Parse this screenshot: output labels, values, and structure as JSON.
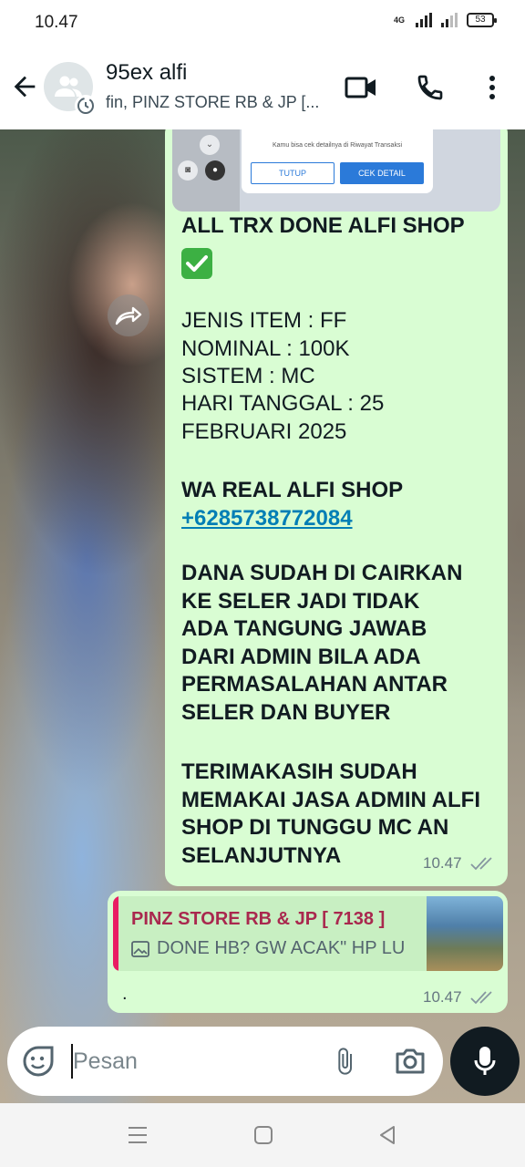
{
  "status_bar": {
    "time": "10.47",
    "network": "4G",
    "battery": "53"
  },
  "header": {
    "title": "95ex alfi",
    "subtitle": "fin, PINZ STORE RB & JP [..."
  },
  "preview": {
    "dialog_text": "Kamu bisa cek detailnya di Riwayat Transaksi",
    "btn_close": "TUTUP",
    "btn_detail": "CEK DETAIL"
  },
  "message1": {
    "headline": "ALL TRX DONE  ALFI SHOP",
    "emoji": "✅",
    "line1": "JENIS ITEM : FF",
    "line2": "NOMINAL : 100K",
    "line3": "SISTEM : MC",
    "line4": "HARI TANGGAL : 25",
    "line5": "FEBRUARI 2025",
    "wa_label": "WA REAL ALFI SHOP",
    "phone": "+6285738772084",
    "notice": "DANA SUDAH DI CAIRKAN\nKE SELER JADI TIDAK\nADA TANGUNG JAWAB\nDARI ADMIN BILA ADA\nPERMASALAHAN ANTAR\nSELER DAN BUYER",
    "thanks": "TERIMAKASIH SUDAH\nMEMAKAI JASA ADMIN ALFI\nSHOP DI TUNGGU MC AN\nSELANJUTNYA",
    "time": "10.47"
  },
  "message2": {
    "quote_name": "PINZ STORE RB & JP [ 7138 ]",
    "quote_text": "DONE HB? GW ACAK\" HP LU",
    "text": ".",
    "time": "10.47"
  },
  "input": {
    "placeholder": "Pesan"
  },
  "icons": {
    "back": "back-arrow-icon",
    "video": "video-call-icon",
    "call": "phone-icon",
    "menu": "more-vert-icon",
    "emoji": "sticker-icon",
    "attach": "paperclip-icon",
    "camera": "camera-icon",
    "mic": "mic-icon",
    "forward": "forward-icon"
  },
  "colors": {
    "bubble": "#d9fdd3",
    "link": "#027eb5",
    "quote_accent": "#e91e63",
    "quote_name": "#a9284e"
  }
}
